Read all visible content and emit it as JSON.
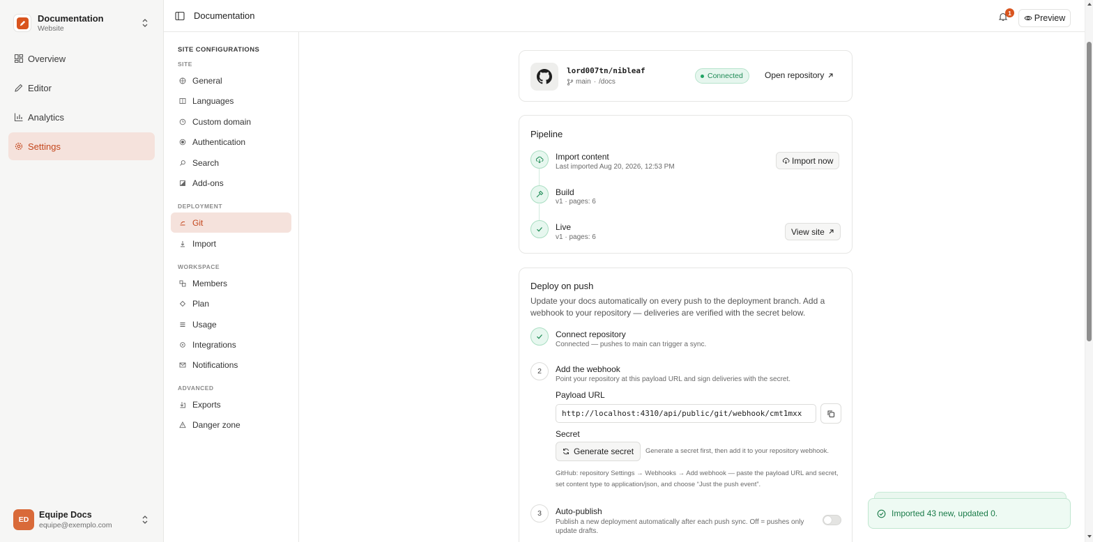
{
  "workspace": {
    "name": "Documentation",
    "subtitle": "Website"
  },
  "nav": [
    {
      "label": "Overview",
      "icon": "layout-grid-icon"
    },
    {
      "label": "Editor",
      "icon": "pen-icon"
    },
    {
      "label": "Analytics",
      "icon": "bar-chart-icon"
    },
    {
      "label": "Settings",
      "icon": "gear-icon",
      "active": true
    }
  ],
  "user": {
    "initials": "ED",
    "name": "Equipe Docs",
    "email": "equipe@exemplo.com"
  },
  "topbar": {
    "title": "Documentation",
    "notifications": "1",
    "preview_label": "Preview"
  },
  "settings_nav": {
    "heading": "SITE CONFIGURATIONS",
    "groups": [
      {
        "label": "SITE",
        "items": [
          "General",
          "Languages",
          "Custom domain",
          "Authentication",
          "Search",
          "Add-ons"
        ]
      },
      {
        "label": "DEPLOYMENT",
        "items": [
          "Git",
          "Import"
        ]
      },
      {
        "label": "WORKSPACE",
        "items": [
          "Members",
          "Plan",
          "Usage",
          "Integrations",
          "Notifications"
        ]
      },
      {
        "label": "ADVANCED",
        "items": [
          "Exports",
          "Danger zone"
        ]
      }
    ],
    "active": "Git"
  },
  "repo": {
    "name": "lord007tn/nibleaf",
    "branch": "main",
    "separator": "·",
    "path": "/docs",
    "status": "Connected",
    "open_label": "Open repository"
  },
  "pipeline": {
    "title": "Pipeline",
    "steps": [
      {
        "title": "Import content",
        "sub": "Last imported Aug 20, 2026, 12:53 PM",
        "action": "Import now"
      },
      {
        "title": "Build",
        "sub": "v1 · pages: 6"
      },
      {
        "title": "Live",
        "sub": "v1 · pages: 6",
        "action": "View site"
      }
    ]
  },
  "deploy": {
    "title": "Deploy on push",
    "description": "Update your docs automatically on every push to the deployment branch. Add a webhook to your repository — deliveries are verified with the secret below.",
    "steps": [
      {
        "title": "Connect repository",
        "sub": "Connected — pushes to main can trigger a sync."
      },
      {
        "num": "2",
        "title": "Add the webhook",
        "sub": "Point your repository at this payload URL and sign deliveries with the secret."
      },
      {
        "num": "3",
        "title": "Auto-publish",
        "sub": "Publish a new deployment automatically after each push sync. Off = pushes only update drafts."
      }
    ],
    "payload_label": "Payload URL",
    "payload_url": "http://localhost:4310/api/public/git/webhook/cmt1mxx",
    "secret_label": "Secret",
    "generate_label": "Generate secret",
    "generate_hint": "Generate a secret first, then add it to your repository webhook.",
    "github_hint": "GitHub: repository Settings → Webhooks → Add webhook — paste the payload URL and secret, set content type to application/json, and choose “Just the push event”.",
    "auto_publish": false
  },
  "toast": {
    "message": "Imported 43 new, updated 0."
  },
  "colors": {
    "accent": "#d9541e",
    "success": "#1fa463"
  }
}
